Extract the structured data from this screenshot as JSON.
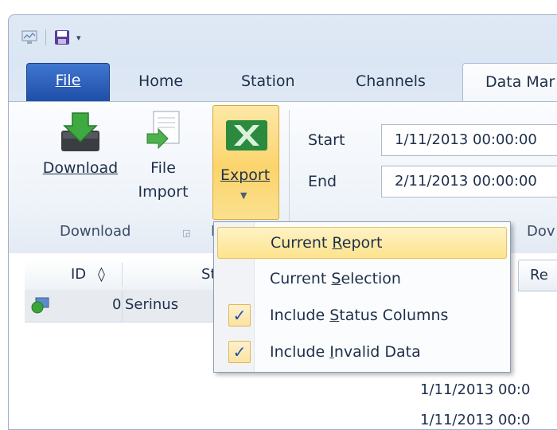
{
  "tabs": {
    "file": "File",
    "home": "Home",
    "station": "Station",
    "channels": "Channels",
    "active": "Data Mar"
  },
  "ribbon": {
    "download_label": "Download",
    "file_import_line1": "File",
    "file_import_line2": "Import",
    "export_label": "Export",
    "start_label": "Start",
    "end_label": "End",
    "start_value": "1/11/2013 00:00:00",
    "end_value": "2/11/2013 00:00:00",
    "group_download": "Download",
    "group_partial_left": "E",
    "group_partial_right": "Dov"
  },
  "grid": {
    "headers": {
      "id": "ID",
      "id_sort": "◊",
      "station": "Sta"
    },
    "rows": [
      {
        "id": "0",
        "station": "Serinus"
      }
    ]
  },
  "right_panel": {
    "tab": "Re",
    "timestamps": [
      "1/11/2013 00:0",
      "1/11/2013 00:0"
    ]
  },
  "menu": {
    "items": [
      {
        "pre": "Current ",
        "ul": "R",
        "post": "eport",
        "checked": false,
        "highlighted": true
      },
      {
        "pre": "Current ",
        "ul": "S",
        "post": "election",
        "checked": false,
        "highlighted": false
      },
      {
        "pre": "Include ",
        "ul": "S",
        "post": "tatus Columns",
        "checked": true,
        "highlighted": false
      },
      {
        "pre": "Include ",
        "ul": "I",
        "post": "nvalid Data",
        "checked": true,
        "highlighted": false
      }
    ]
  },
  "colors": {
    "file_tab": "#2a5fbc",
    "excel_green": "#1e7b34",
    "highlight": "#fde38c",
    "check_blue": "#1f4fa8"
  }
}
